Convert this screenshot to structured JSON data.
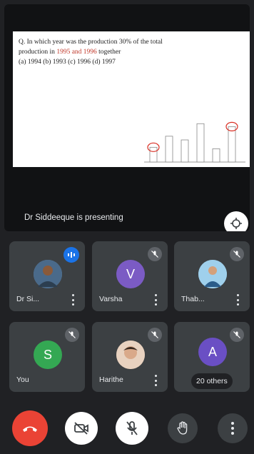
{
  "presentation": {
    "slide_line1": "Q. In which year was the production 30% of the total",
    "slide_line2_a": "production in ",
    "slide_line2_hl": "1995 and 1996",
    "slide_line2_b": " together",
    "slide_line3": "(a) 1994 (b) 1993 (c) 1996 (d) 1997",
    "presenting_text": "Dr Siddeeque is presenting"
  },
  "chart_data": {
    "type": "bar",
    "title": "",
    "categories": [],
    "values": [
      20,
      35,
      30,
      52,
      18,
      48
    ]
  },
  "participants": [
    {
      "name": "Dr Si...",
      "initial": "",
      "avatar_type": "photo",
      "avatar_color": "#6d8fb3",
      "status": "speaking"
    },
    {
      "name": "Varsha",
      "initial": "V",
      "avatar_type": "letter",
      "avatar_color": "#7b5bc4",
      "status": "muted"
    },
    {
      "name": "Thab...",
      "initial": "",
      "avatar_type": "photo",
      "avatar_color": "#7fb7d9",
      "status": "muted"
    },
    {
      "name": "You",
      "initial": "S",
      "avatar_type": "letter",
      "avatar_color": "#34a853",
      "status": "muted"
    },
    {
      "name": "Harithe",
      "initial": "",
      "avatar_type": "photo",
      "avatar_color": "#c9a58a",
      "status": "muted"
    },
    {
      "name": "",
      "initial": "A",
      "avatar_type": "letter",
      "avatar_color": "#6a4fc4",
      "status": "muted"
    }
  ],
  "others_label": "20 others",
  "colors": {
    "background": "#202124",
    "tile": "#3c4043",
    "end_call": "#ea4335",
    "speaking": "#1a73e8"
  },
  "controls": [
    "end-call",
    "camera-off",
    "mic-off",
    "raise-hand",
    "more-options"
  ]
}
